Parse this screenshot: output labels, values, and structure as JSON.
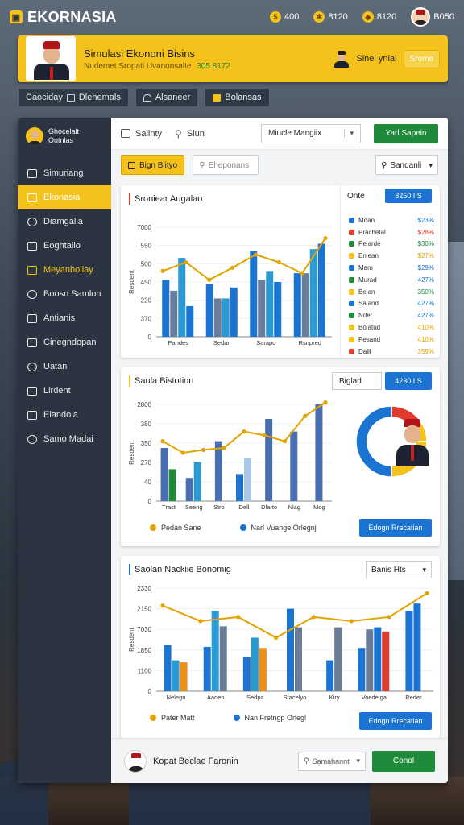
{
  "app": {
    "brand": "EKORNASIA",
    "stats": [
      {
        "icon": "coin-icon",
        "value": "400"
      },
      {
        "icon": "gear-coin-icon",
        "value": "8120"
      },
      {
        "icon": "gem-icon",
        "value": "8120"
      },
      {
        "icon": "avatar-icon",
        "value": "B050"
      }
    ]
  },
  "banner": {
    "title": "Simulasi Ekononi Bisins",
    "subtitle": "Nudemet Sropati Uvanonsalte",
    "highlight": "305 8172",
    "right_label": "Sinel ynial",
    "button": "Sroma"
  },
  "tabs": [
    {
      "label": "Caociday"
    },
    {
      "label": "Dlehemals"
    },
    {
      "label": "Alsaneer"
    },
    {
      "label": "Bolansas"
    }
  ],
  "sidebar": {
    "user_line1": "Ghocelalt",
    "user_line2": "Outnlas",
    "items": [
      {
        "label": "Simuriang",
        "state": "normal"
      },
      {
        "label": "Ekonasia",
        "state": "active"
      },
      {
        "label": "Diamgalia",
        "state": "normal"
      },
      {
        "label": "Eoghtaiio",
        "state": "normal"
      },
      {
        "label": "Meyanboliay",
        "state": "highlight"
      },
      {
        "label": "Boosn Samlon",
        "state": "normal"
      },
      {
        "label": "Antianis",
        "state": "normal"
      },
      {
        "label": "Cinegndopan",
        "state": "normal"
      },
      {
        "label": "Uatan",
        "state": "normal"
      },
      {
        "label": "Lirdent",
        "state": "normal"
      },
      {
        "label": "Elandola",
        "state": "normal"
      },
      {
        "label": "Samo Madai",
        "state": "normal"
      }
    ]
  },
  "toolbar": {
    "link1": "Salinty",
    "link2": "Slun",
    "select": "Miucle Mangiix",
    "button": "Yarl Sapein"
  },
  "filterbar": {
    "chip": "Bign Biityo",
    "search_placeholder": "Eheponans",
    "select": "Sandanli"
  },
  "card1": {
    "title": "Sroniear Augalao",
    "panel_title": "Onte",
    "panel_button": "3250.IIS",
    "legend": [
      {
        "label": "Mdan",
        "value": "$23%",
        "color": "#1b74d1",
        "value_color": "#1b74d1"
      },
      {
        "label": "Prachetal",
        "value": "$28%",
        "color": "#e23b2e",
        "value_color": "#e23b2e"
      },
      {
        "label": "Pelarde",
        "value": "$30%",
        "color": "#1f8a3a",
        "value_color": "#1f8a3a"
      },
      {
        "label": "Enlean",
        "value": "$27%",
        "color": "#f4c21a",
        "value_color": "#e2a400"
      },
      {
        "label": "Mam",
        "value": "$29%",
        "color": "#1b74d1",
        "value_color": "#1b74d1"
      },
      {
        "label": "Murad",
        "value": "427%",
        "color": "#1f8a3a",
        "value_color": "#1b74d1"
      },
      {
        "label": "Belan",
        "value": "350%",
        "color": "#f4c21a",
        "value_color": "#1f8a3a"
      },
      {
        "label": "Saland",
        "value": "427%",
        "color": "#1b74d1",
        "value_color": "#1b74d1"
      },
      {
        "label": "Nder",
        "value": "427%",
        "color": "#1f8a3a",
        "value_color": "#1b74d1"
      },
      {
        "label": "Bolatud",
        "value": "410%",
        "color": "#f4c21a",
        "value_color": "#e2a400"
      },
      {
        "label": "Pesand",
        "value": "410%",
        "color": "#f4c21a",
        "value_color": "#e2a400"
      },
      {
        "label": "Dalil",
        "value": "359%",
        "color": "#e23b2e",
        "value_color": "#e2a400"
      }
    ]
  },
  "card2": {
    "title": "Saula Bistotion",
    "select": "Biglad",
    "button": "4230.IIS",
    "legend": [
      {
        "label": "Pedan Sane",
        "color": "#e2a400"
      },
      {
        "label": "Narl Vuange Orlegnj",
        "color": "#1b74d1"
      }
    ],
    "action": "Edogn Rrecatian"
  },
  "card3": {
    "title": "Saolan Nackiie Bonomig",
    "select": "Banis Hts",
    "legend": [
      {
        "label": "Pater Matt",
        "color": "#e2a400"
      },
      {
        "label": "Nan Fretngp Orlegl",
        "color": "#1b74d1"
      }
    ],
    "action": "Edogn Rrecatian"
  },
  "footer": {
    "label": "Kopat Beclae Faronin",
    "search_placeholder": "Samahannt",
    "button": "Conol"
  },
  "chart_data": [
    {
      "type": "bar",
      "title": "Sroniear Augalao",
      "ylabel": "Resdent",
      "y_tick_labels": [
        "7000",
        "550",
        "500",
        "450",
        "220",
        "370",
        "0"
      ],
      "categories": [
        "Pandes",
        "Sedan",
        "Sarapo",
        "Rsnpred"
      ],
      "series": [
        {
          "color": "#1b74d1",
          "values": [
            0.52,
            0.48,
            0.78,
            0.58
          ]
        },
        {
          "color": "#6b7d99",
          "values": [
            0.42,
            0.35,
            0.52,
            0.58
          ]
        },
        {
          "color": "#2a9ad3",
          "values": [
            0.72,
            0.35,
            0.6,
            0.8
          ]
        },
        {
          "color": "#1b74d1",
          "values": [
            0.28,
            0.45,
            0.5,
            0.85
          ]
        }
      ],
      "line": {
        "color": "#e2a400",
        "values": [
          0.6,
          0.68,
          0.52,
          0.63,
          0.75,
          0.68,
          0.58,
          0.9
        ]
      }
    },
    {
      "type": "bar",
      "title": "Saula Bistotion",
      "ylabel": "Resdent",
      "y_tick_labels": [
        "2800",
        "380",
        "350",
        "270",
        "40",
        "0"
      ],
      "categories": [
        "Trast",
        "Seeng",
        "Stro",
        "Dell",
        "Dlarto",
        "Nlag",
        "Mog"
      ],
      "series": [
        {
          "color": "#4a6fb0",
          "values": [
            0.55,
            0.0,
            0.62,
            0.0,
            0.85,
            0.0,
            1.0
          ]
        },
        {
          "color": "#1f8a3a",
          "values": [
            0.33,
            0.0,
            0.0,
            0.0,
            0.0,
            0.0,
            0.0
          ]
        },
        {
          "color": "#4a6fb0",
          "values": [
            0.0,
            0.24,
            0.0,
            0.0,
            0.0,
            0.72,
            0.0
          ]
        },
        {
          "color": "#2a9ad3",
          "values": [
            0.0,
            0.4,
            0.0,
            0.0,
            0.0,
            0.0,
            0.0
          ]
        },
        {
          "color": "#1b74d1",
          "values": [
            0.0,
            0.0,
            0.0,
            0.28,
            0.0,
            0.0,
            0.0
          ]
        },
        {
          "color": "#a9c7e8",
          "values": [
            0.0,
            0.0,
            0.0,
            0.45,
            0.0,
            0.0,
            0.0
          ]
        }
      ],
      "line": {
        "color": "#e2a400",
        "values": [
          0.62,
          0.5,
          0.53,
          0.55,
          0.72,
          0.68,
          0.62,
          0.88,
          1.03
        ]
      }
    },
    {
      "type": "bar",
      "title": "Saolan Nackiie Bonomig",
      "ylabel": "Resdent",
      "y_tick_labels": [
        "2330",
        "2150",
        "7030",
        "1850",
        "1100",
        "0"
      ],
      "categories": [
        "Nelegn",
        "Aaden",
        "Sedpa",
        "Stacelyo",
        "Kiry",
        "Voedelga",
        "Reder"
      ],
      "series": [
        {
          "color": "#1b74d1",
          "values": [
            0.45,
            0.43,
            0.33,
            0.8,
            0.3,
            0.42,
            0.78
          ]
        },
        {
          "color": "#2a9ad3",
          "values": [
            0.3,
            0.78,
            0.52,
            0.0,
            0.0,
            0.0,
            0.0
          ]
        },
        {
          "color": "#e8901a",
          "values": [
            0.28,
            0.0,
            0.42,
            0.0,
            0.0,
            0.0,
            0.0
          ]
        },
        {
          "color": "#6b7d99",
          "values": [
            0.0,
            0.63,
            0.0,
            0.62,
            0.62,
            0.6,
            0.0
          ]
        },
        {
          "color": "#1b74d1",
          "values": [
            0.0,
            0.0,
            0.0,
            0.0,
            0.0,
            0.62,
            0.85
          ]
        },
        {
          "color": "#e23b2e",
          "values": [
            0.0,
            0.0,
            0.0,
            0.0,
            0.0,
            0.58,
            0.0
          ]
        }
      ],
      "line": {
        "color": "#e2a400",
        "values": [
          0.83,
          0.68,
          0.72,
          0.52,
          0.72,
          0.68,
          0.72,
          0.95
        ]
      }
    }
  ],
  "donut": {
    "segments": [
      {
        "value": 15,
        "color": "#e23b2e"
      },
      {
        "value": 10,
        "color": "#f4c21a"
      },
      {
        "value": 25,
        "color": "#f4c21a"
      },
      {
        "value": 50,
        "color": "#1b74d1"
      }
    ]
  }
}
